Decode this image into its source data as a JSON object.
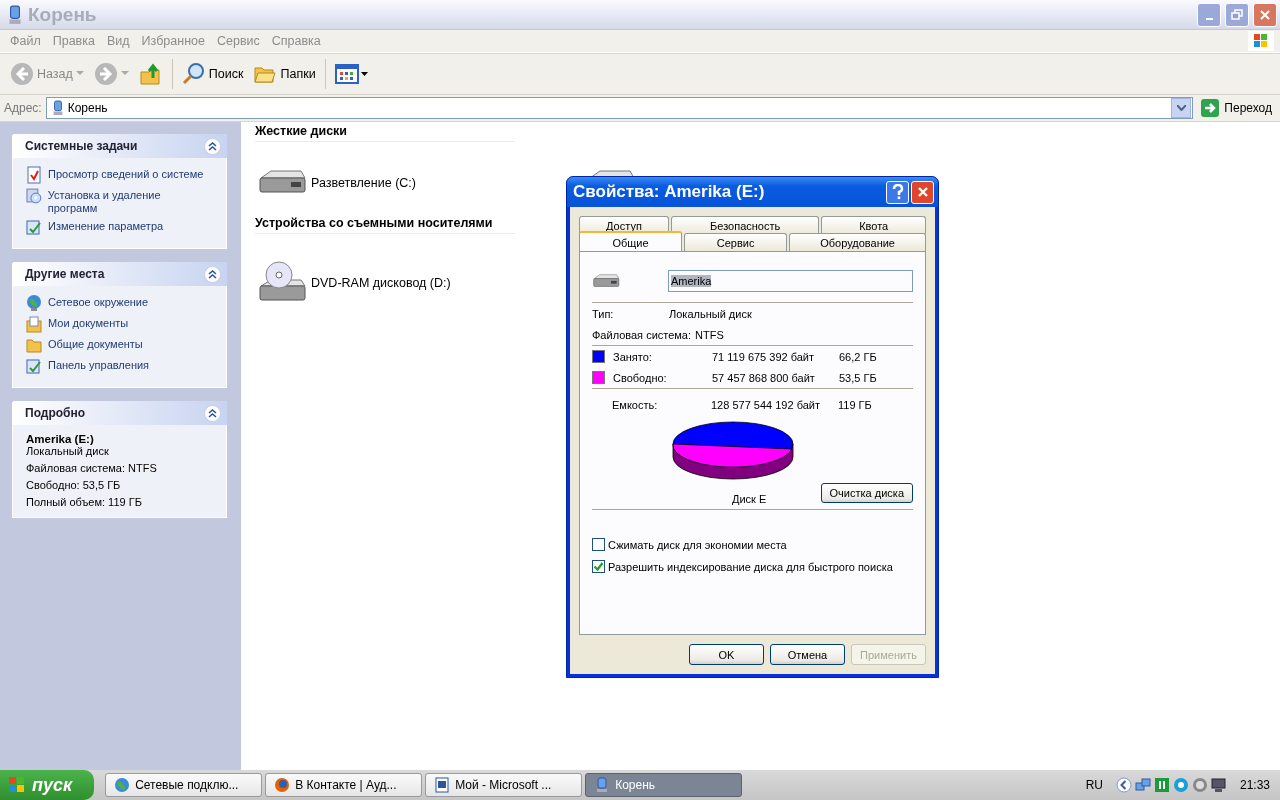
{
  "window": {
    "title": "Корень",
    "active": false
  },
  "menu": [
    "Файл",
    "Правка",
    "Вид",
    "Избранное",
    "Сервис",
    "Справка"
  ],
  "toolbar": [
    {
      "kind": "back",
      "label": "Назад",
      "disabled": true
    },
    {
      "kind": "forward",
      "disabled": true
    },
    {
      "kind": "up"
    },
    {
      "kind": "search",
      "label": "Поиск"
    },
    {
      "kind": "folders",
      "label": "Папки"
    },
    {
      "kind": "views"
    }
  ],
  "address": {
    "label": "Адрес:",
    "value": "Корень",
    "go": "Переход"
  },
  "sidebar": [
    {
      "title": "Системные задачи",
      "kind": "links",
      "items": [
        "Просмотр сведений о системе",
        "Установка и удаление программ",
        "Изменение параметра"
      ]
    },
    {
      "title": "Другие места",
      "kind": "links",
      "items": [
        "Сетевое окружение",
        "Мои документы",
        "Общие документы",
        "Панель управления"
      ]
    },
    {
      "title": "Подробно",
      "kind": "details",
      "name": "Amerika (E:)",
      "items": [
        "Локальный диск",
        "Файловая система: NTFS",
        "Свободно: 53,5 ГБ",
        "Полный объем: 119 ГБ"
      ]
    }
  ],
  "groups": [
    {
      "title": "Жесткие диски",
      "items": [
        {
          "kind": "hdd",
          "label": "Разветвление (C:)"
        },
        {
          "kind": "hdd"
        }
      ]
    },
    {
      "title": "Устройства со съемными носителями",
      "items": [
        {
          "kind": "dvd",
          "label": "DVD-RAM дисковод (D:)"
        }
      ]
    }
  ],
  "dialog": {
    "title": "Свойства: Amerika (E:)",
    "tabs_back": [
      {
        "label": "Доступ",
        "selected": false
      },
      {
        "label": "Безопасность",
        "selected": false
      },
      {
        "label": "Квота",
        "selected": false
      }
    ],
    "tabs_front": [
      {
        "label": "Общие",
        "selected": true
      },
      {
        "label": "Сервис",
        "selected": false
      },
      {
        "label": "Оборудование",
        "selected": false
      }
    ],
    "name": "Amerika",
    "info": [
      {
        "label": "Тип:",
        "value": "Локальный диск"
      },
      {
        "label": "Файловая система:",
        "value": "NTFS"
      }
    ],
    "usage": [
      {
        "label": "Занято:",
        "bytes": "71 119 675 392 байт",
        "size": "66,2 ГБ",
        "color": "#0000ff"
      },
      {
        "label": "Свободно:",
        "bytes": "57 457 868 800 байт",
        "size": "53,5 ГБ",
        "color": "#ff00ff"
      }
    ],
    "capacity": {
      "label": "Емкость:",
      "bytes": "128 577 544 192 байт",
      "size": "119 ГБ"
    },
    "pie_caption": "Диск E",
    "cleanup": "Очистка диска",
    "options": [
      {
        "label": "Сжимать диск для экономии места",
        "checked": false
      },
      {
        "label": "Разрешить индексирование диска для быстрого поиска",
        "checked": true
      }
    ],
    "buttons": [
      {
        "label": "OK",
        "disabled": false
      },
      {
        "label": "Отмена",
        "disabled": false
      },
      {
        "label": "Применить",
        "disabled": true
      }
    ]
  },
  "taskbar": {
    "start": "пуск",
    "tasks": [
      {
        "label": "Сетевые подклю...",
        "selected": false
      },
      {
        "label": "В Контакте | Ауд...",
        "selected": false
      },
      {
        "label": "Мой - Microsoft ...",
        "selected": false
      },
      {
        "label": "Корень",
        "selected": true
      }
    ],
    "lang": "RU",
    "clock": "21:33"
  }
}
